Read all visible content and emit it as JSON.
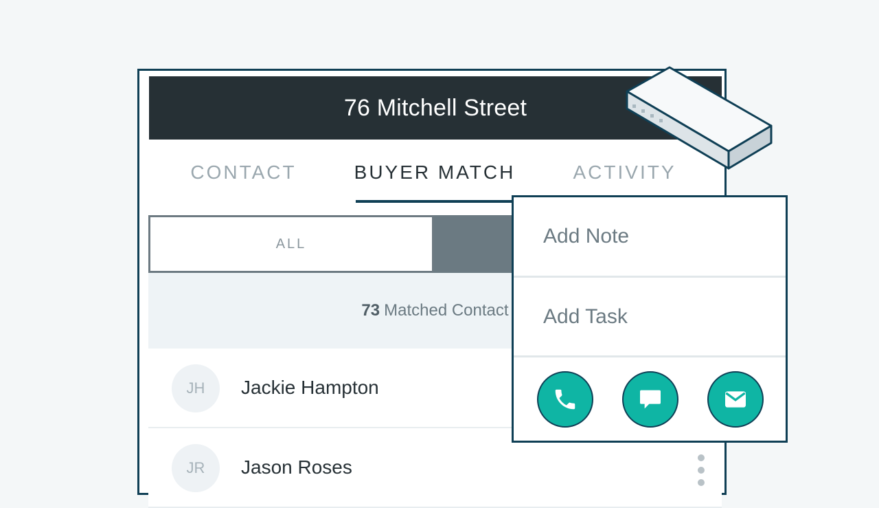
{
  "header": {
    "title": "76 Mitchell Street"
  },
  "tabs": [
    {
      "label": "CONTACT",
      "active": false
    },
    {
      "label": "BUYER MATCH",
      "active": true
    },
    {
      "label": "ACTIVITY",
      "active": false
    }
  ],
  "segments": {
    "all_label": "ALL"
  },
  "matched": {
    "count": "73",
    "label": "Matched Contact"
  },
  "contacts": [
    {
      "initials": "JH",
      "name": "Jackie Hampton"
    },
    {
      "initials": "JR",
      "name": "Jason Roses"
    }
  ],
  "popup": {
    "items": [
      "Add Note",
      "Add Task"
    ],
    "actions": [
      "phone-icon",
      "message-icon",
      "mail-icon"
    ]
  },
  "colors": {
    "accent": "#0fb5a4",
    "border": "#0f3f55",
    "header_bg": "#263035"
  }
}
